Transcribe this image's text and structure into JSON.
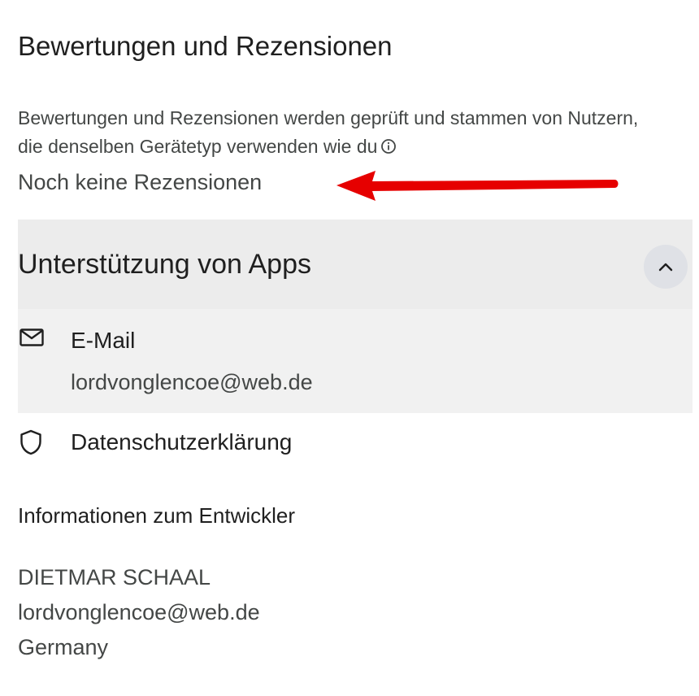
{
  "ratings": {
    "title": "Bewertungen und Rezensionen",
    "description": "Bewertungen und Rezensionen werden geprüft und stammen von Nutzern, die denselben Gerätetyp verwenden wie du",
    "info_icon": "info-icon",
    "empty_state": "Noch keine Rezensionen",
    "annotation": {
      "icon": "red-arrow-pointing-left",
      "color": "#e60000"
    }
  },
  "app_support": {
    "title": "Unterstützung von Apps",
    "expanded": true,
    "toggle_icon": "chevron-up-icon",
    "email": {
      "icon": "mail-icon",
      "label": "E-Mail",
      "value": "lordvonglencoe@web.de"
    },
    "privacy": {
      "icon": "shield-icon",
      "label": "Datenschutzerklärung"
    },
    "developer": {
      "title": "Informationen zum Entwickler",
      "name": "DIETMAR SCHAAL",
      "email": "lordvonglencoe@web.de",
      "country": "Germany"
    }
  },
  "colors": {
    "header_bg": "#ececec",
    "email_row_bg": "#f1f1f1",
    "chevron_button_bg": "#dfe1e6",
    "primary_text": "#1f1f1f",
    "secondary_text": "#444746",
    "annotation_red": "#e60000"
  }
}
